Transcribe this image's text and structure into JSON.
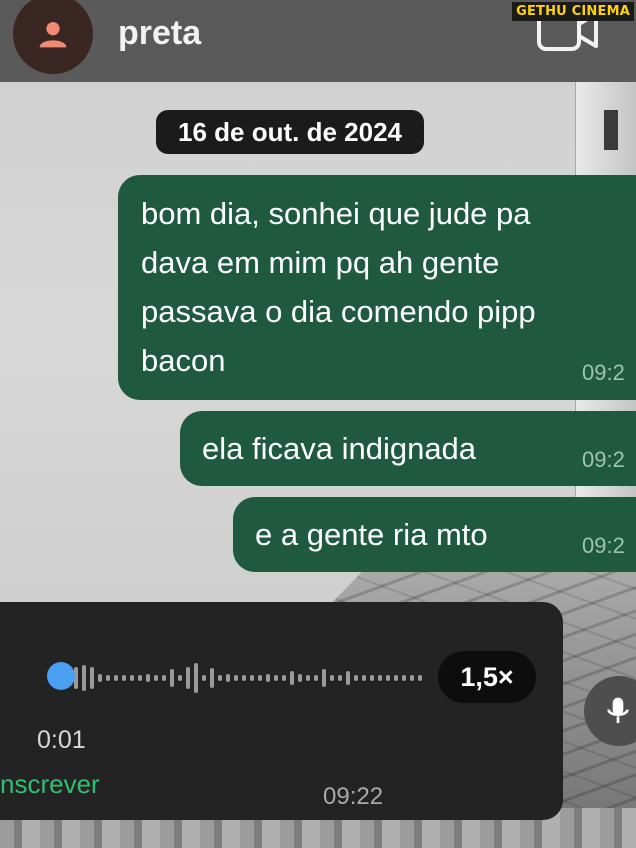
{
  "header": {
    "contact_name": "preta",
    "avatar_icon": "person-icon",
    "video_icon": "video-camera-icon",
    "watermark": "GETHU CINEMA"
  },
  "date_separator": "16 de out. de 2024",
  "messages": [
    {
      "text": "bom dia, sonhei que jude pa\ndava em mim pq ah gente\npassava o dia comendo pipp\nbacon",
      "time": "09:2"
    },
    {
      "text": "ela ficava indignada",
      "time": "09:2"
    },
    {
      "text": "e a gente ria mto",
      "time": "09:2"
    }
  ],
  "audio_message": {
    "elapsed": "0:01",
    "speed_label": "1,5×",
    "transcribe_label": "nscrever",
    "time": "09:22",
    "progress": 0.02
  },
  "composer": {
    "mic_icon": "microphone-icon"
  },
  "colors": {
    "header_bg": "#5a5a5a",
    "bubble_out": "#1f5a40",
    "audio_card": "#232323",
    "progress_knob": "#4a9ff0",
    "transcribe_link": "#2fbf71",
    "avatar_icon": "#f08a72"
  }
}
